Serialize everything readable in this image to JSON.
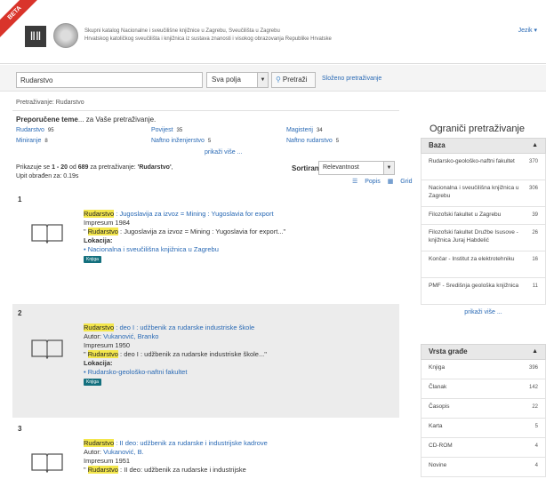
{
  "header": {
    "beta": "BETA",
    "logo_text": "ⅡⅡ",
    "line1": "Skupni katalog Nacionalne i sveučilišne knjižnice u Zagrebu, Sveučilišta u Zagrebu",
    "line2": "Hrvatskog katoličkog sveučilišta i knjižnica iz sustava znanosti i visokog obrazovanja Republike Hrvatske",
    "language": "Jezik ▾"
  },
  "search": {
    "value": "Rudarstvo",
    "field_select": "Sva polja",
    "button": "Pretraži",
    "advanced": "Složeno pretraživanje"
  },
  "breadcrumb": "Pretraživanje: Rudarstvo",
  "recommended": {
    "title_bold": "Preporučene teme",
    "title_rest": "... za Vaše pretraživanje.",
    "items": [
      {
        "label": "Rudarstvo",
        "count": "95"
      },
      {
        "label": "Povijest",
        "count": "35"
      },
      {
        "label": "Magisterij",
        "count": "34"
      },
      {
        "label": "Miniranje",
        "count": "8"
      },
      {
        "label": "Naftno inženjerstvo",
        "count": "5"
      },
      {
        "label": "Naftno rudarstvo",
        "count": "5"
      }
    ],
    "show_more": "prikaži više ..."
  },
  "results_info": {
    "prefix": "Prikazuje se",
    "range": "1 - 20",
    "of": "od",
    "total": "689",
    "for": "za pretraživanje:",
    "query": "'Rudarstvo'",
    "time": "Upit obrađen za: 0.19s"
  },
  "sort": {
    "label": "Sortiranje",
    "value": "Relevantnost",
    "list_view": "Popis",
    "grid_view": "Grid"
  },
  "results": [
    {
      "num": "1",
      "hl": "Rudarstvo",
      "title": ": Jugoslavija za izvoz = Mining : Yugoslavia for export",
      "author_label": "",
      "author": "",
      "impressum": "Impresum 1984",
      "snippet_pre": "\"",
      "snippet_hl": "Rudarstvo",
      "snippet_post": ": Jugoslavija za izvoz = Mining : Yugoslavia for export...\"",
      "location_label": "Lokacija:",
      "location": "• Nacionalna i sveučilišna knjižnica u Zagrebu",
      "badge": "Knjiga"
    },
    {
      "num": "2",
      "hl": "Rudarstvo",
      "title": ": deo I : udžbenik za rudarske industriske škole",
      "author_label": "Autor:",
      "author": "Vukanović, Branko",
      "impressum": "Impresum 1950",
      "snippet_pre": "\"",
      "snippet_hl": "Rudarstvo",
      "snippet_post": ": deo I : udžbenik za rudarske industriske škole...\"",
      "location_label": "Lokacija:",
      "location": "• Rudarsko-geološko-naftni fakultet",
      "badge": "Knjiga"
    },
    {
      "num": "3",
      "hl": "Rudarstvo",
      "title": ": II deo: udžbenik za rudarske i industrijske kadrove",
      "author_label": "Autor:",
      "author": "Vukanović, B.",
      "impressum": "Impresum 1951",
      "snippet_pre": "\"",
      "snippet_hl": "Rudarstvo",
      "snippet_post": ": II deo: udžbenik za rudarske i industrijske",
      "location_label": "",
      "location": "",
      "badge": ""
    }
  ],
  "sidebar": {
    "title": "Ograniči pretraživanje",
    "baza": {
      "heading": "Baza",
      "items": [
        {
          "label": "Rudarsko-geološko-naftni fakultet",
          "count": "370"
        },
        {
          "label": "Nacionalna i sveučilišna knjižnica u Zagrebu",
          "count": "306"
        },
        {
          "label": "Filozofski fakultet u Zagrebu",
          "count": "39"
        },
        {
          "label": "Filozofski fakultet Družbe Isusove - knjižnica Juraj Habdelić",
          "count": "26"
        },
        {
          "label": "Končar - Institut za elektrotehniku",
          "count": "16"
        },
        {
          "label": "PMF - Središnja geološka knjižnica",
          "count": "11"
        }
      ],
      "show_more": "prikaži više ..."
    },
    "vrsta": {
      "heading": "Vrsta građe",
      "items": [
        {
          "label": "Knjiga",
          "count": "396"
        },
        {
          "label": "Članak",
          "count": "142"
        },
        {
          "label": "Časopis",
          "count": "22"
        },
        {
          "label": "Karta",
          "count": "5"
        },
        {
          "label": "CD-ROM",
          "count": "4"
        },
        {
          "label": "Novine",
          "count": "4"
        }
      ]
    }
  }
}
